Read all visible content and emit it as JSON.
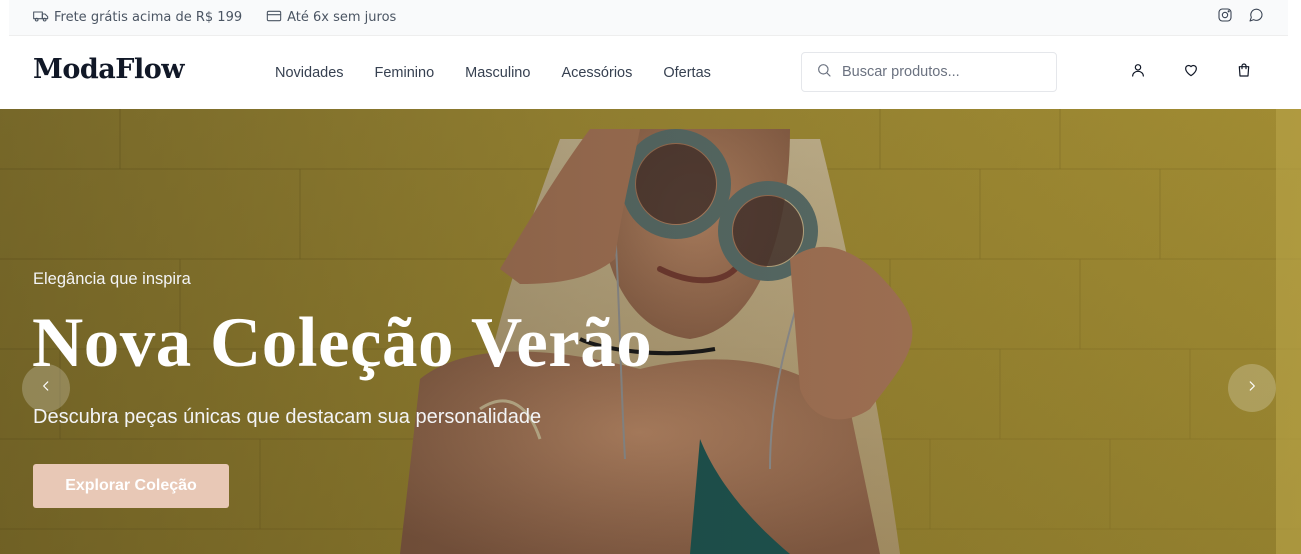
{
  "topbar": {
    "shipping_text": "Frete grátis acima de R$ 199",
    "shipping_icon": "truck-icon",
    "installments_text": "Até 6x sem juros",
    "installments_icon": "credit-card-icon",
    "social": [
      "instagram-icon",
      "chat-icon"
    ]
  },
  "header": {
    "logo": "ModaFlow",
    "nav": [
      "Novidades",
      "Feminino",
      "Masculino",
      "Acessórios",
      "Ofertas"
    ],
    "search": {
      "placeholder": "Buscar produtos...",
      "value": ""
    },
    "icons": [
      "user-icon",
      "heart-icon",
      "shopping-bag-icon"
    ]
  },
  "hero": {
    "eyebrow": "Elegância que inspira",
    "title": "Nova Coleção Verão",
    "subtitle": "Descubra peças únicas que destacam sua personalidade",
    "cta_label": "Explorar Coleção",
    "cta_color": "#e8c8b6",
    "prev_icon": "chevron-left-icon",
    "next_icon": "chevron-right-icon"
  }
}
